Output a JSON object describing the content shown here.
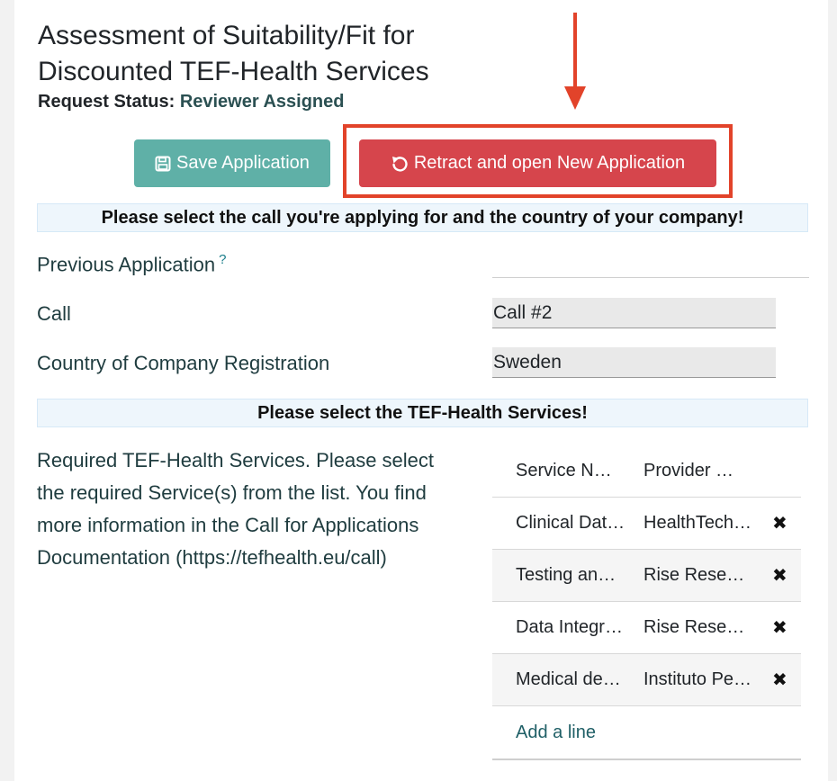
{
  "header": {
    "title": "Assessment of Suitability/Fit for Discounted TEF-Health Services",
    "status_label": "Request Status:",
    "status_value": "Reviewer Assigned"
  },
  "buttons": {
    "save_icon": "floppy-disk-icon",
    "save_label": "Save Application",
    "retract_icon": "undo-icon",
    "retract_label": "Retract and open New Application"
  },
  "annotation": {
    "color": "#e2432a"
  },
  "section1": {
    "banner": "Please select the call you're applying for and the country of your company!",
    "previous_application_label": "Previous Application",
    "help_mark": "?",
    "previous_application_value": "",
    "call_label": "Call",
    "call_value": "Call #2",
    "country_label": "Country of Company Registration",
    "country_value": "Sweden"
  },
  "section2": {
    "banner": "Please select the TEF-Health Services!",
    "description": "Required TEF-Health Services. Please select the required Service(s) from the list. You find more information in the Call for Applications Documentation (https://tefhealth.eu/call)",
    "columns": [
      "Service N…",
      "Provider …"
    ],
    "rows": [
      {
        "service": "Clinical Dat…",
        "provider": "HealthTech…"
      },
      {
        "service": "Testing an…",
        "provider": "Rise Rese…"
      },
      {
        "service": "Data Integr…",
        "provider": "Rise Rese…"
      },
      {
        "service": "Medical de…",
        "provider": "Instituto Pe…"
      }
    ],
    "delete_glyph": "✖",
    "add_line": "Add a line"
  }
}
